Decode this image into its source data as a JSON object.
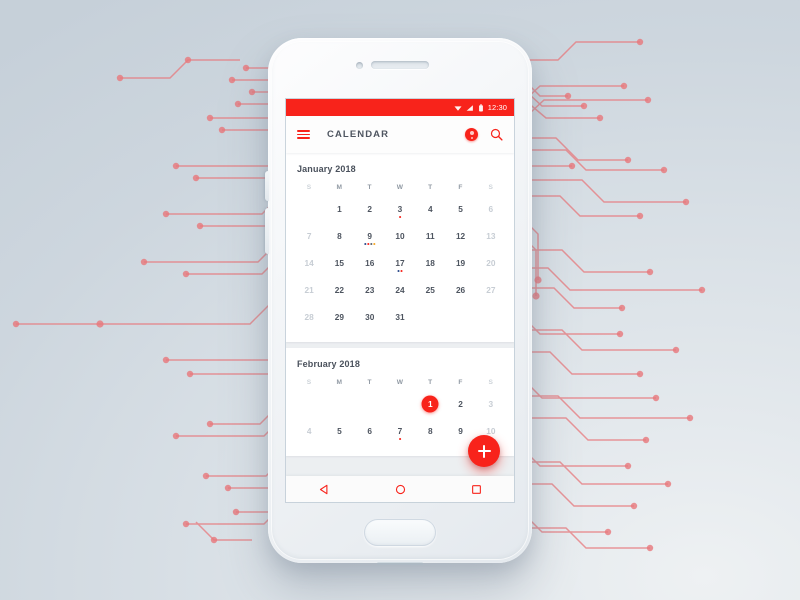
{
  "background": {
    "base_color": "#cfd7de",
    "circuit_color": "#e8787c"
  },
  "device": {
    "name": "android-smartphone-mockup",
    "body_color": "#f2f5f8",
    "parts": {
      "earpiece": "earpiece-speaker",
      "camera": "front-camera",
      "home": "home-button",
      "power": "power-button",
      "volume": "volume-button"
    }
  },
  "status_bar": {
    "background": "#f8231b",
    "time": "12:30",
    "icons": [
      "wifi-icon",
      "signal-icon",
      "battery-icon"
    ]
  },
  "app_bar": {
    "menu_icon": "hamburger-menu-icon",
    "title": "CALENDAR",
    "avatar": "user-avatar",
    "search_icon": "search-icon",
    "accent": "#f8231b"
  },
  "accent_color": "#f8231b",
  "calendar": {
    "day_headers": [
      "S",
      "M",
      "T",
      "W",
      "T",
      "F",
      "S"
    ],
    "months": [
      {
        "title": "January 2018",
        "weeks": [
          [
            {
              "label": "",
              "empty": true
            },
            {
              "label": "1"
            },
            {
              "label": "2"
            },
            {
              "label": "3",
              "dots": [
                "#f8231b"
              ]
            },
            {
              "label": "4"
            },
            {
              "label": "5"
            },
            {
              "label": "6",
              "weekend": true
            }
          ],
          [
            {
              "label": "7",
              "weekend": true
            },
            {
              "label": "8"
            },
            {
              "label": "9",
              "dots": [
                "#2b4a8b",
                "#f8231b",
                "#5b6470",
                "#f5a623"
              ]
            },
            {
              "label": "10"
            },
            {
              "label": "11"
            },
            {
              "label": "12"
            },
            {
              "label": "13",
              "weekend": true
            }
          ],
          [
            {
              "label": "14",
              "weekend": true
            },
            {
              "label": "15"
            },
            {
              "label": "16"
            },
            {
              "label": "17",
              "dots": [
                "#2b4a8b",
                "#f8231b"
              ]
            },
            {
              "label": "18"
            },
            {
              "label": "19"
            },
            {
              "label": "20",
              "weekend": true
            }
          ],
          [
            {
              "label": "21",
              "weekend": true
            },
            {
              "label": "22"
            },
            {
              "label": "23"
            },
            {
              "label": "24"
            },
            {
              "label": "25"
            },
            {
              "label": "26"
            },
            {
              "label": "27",
              "weekend": true
            }
          ],
          [
            {
              "label": "28",
              "weekend": true
            },
            {
              "label": "29"
            },
            {
              "label": "30"
            },
            {
              "label": "31"
            },
            {
              "label": "",
              "empty": true
            },
            {
              "label": "",
              "empty": true
            },
            {
              "label": "",
              "empty": true
            }
          ]
        ]
      },
      {
        "title": "February 2018",
        "weeks": [
          [
            {
              "label": "",
              "empty": true
            },
            {
              "label": "",
              "empty": true
            },
            {
              "label": "",
              "empty": true
            },
            {
              "label": "",
              "empty": true
            },
            {
              "label": "1",
              "selected": true
            },
            {
              "label": "2"
            },
            {
              "label": "3",
              "weekend": true
            }
          ],
          [
            {
              "label": "4",
              "weekend": true
            },
            {
              "label": "5"
            },
            {
              "label": "6"
            },
            {
              "label": "7",
              "dots": [
                "#f8231b"
              ]
            },
            {
              "label": "8"
            },
            {
              "label": "9"
            },
            {
              "label": "10",
              "weekend": true
            }
          ]
        ]
      }
    ]
  },
  "fab": {
    "icon": "plus-icon",
    "color": "#f8231b"
  },
  "nav_bar": {
    "back": "back-triangle-icon",
    "home": "home-circle-icon",
    "recents": "recents-square-icon",
    "color": "#f8231b"
  }
}
